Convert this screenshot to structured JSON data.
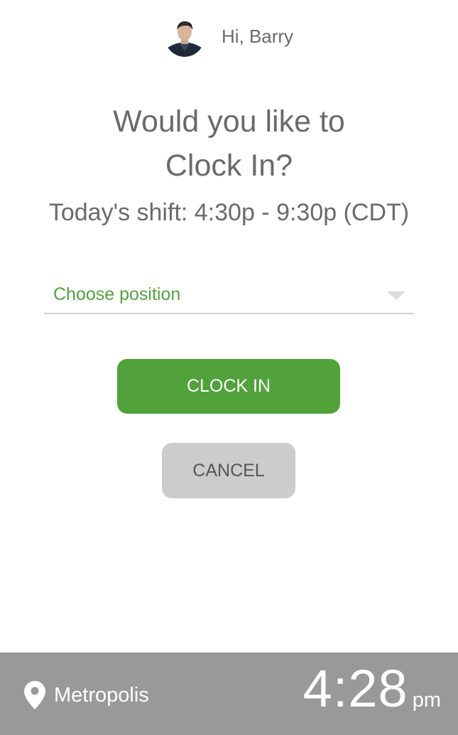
{
  "header": {
    "greeting": "Hi, Barry"
  },
  "prompt": {
    "line1": "Would you like to",
    "line2": "Clock In?"
  },
  "shift": {
    "text": "Today's shift: 4:30p - 9:30p (CDT)"
  },
  "position_select": {
    "placeholder": "Choose position"
  },
  "buttons": {
    "clock_in": "CLOCK IN",
    "cancel": "CANCEL"
  },
  "footer": {
    "location_icon": "map-pin-icon",
    "location": "Metropolis",
    "time": "4:28",
    "ampm": "pm"
  },
  "colors": {
    "accent_green": "#52a23b",
    "footer_gray": "#999999",
    "cancel_gray": "#cccccc",
    "text_gray": "#6a6a6a"
  }
}
